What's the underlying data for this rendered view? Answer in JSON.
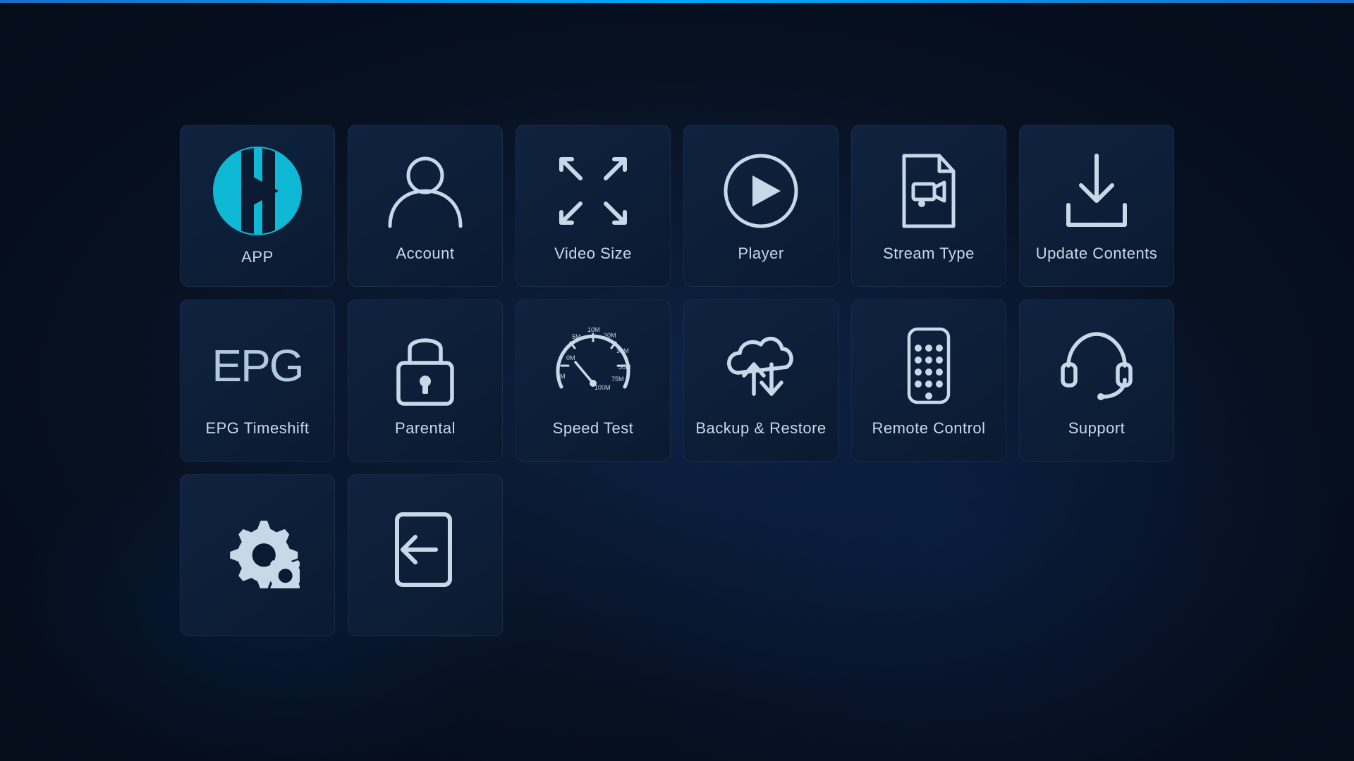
{
  "tiles": [
    {
      "id": "app",
      "label": "APP",
      "icon_type": "app_logo"
    },
    {
      "id": "account",
      "label": "Account",
      "icon_type": "account"
    },
    {
      "id": "video_size",
      "label": "Video Size",
      "icon_type": "video_size"
    },
    {
      "id": "player",
      "label": "Player",
      "icon_type": "player"
    },
    {
      "id": "stream_type",
      "label": "Stream Type",
      "icon_type": "stream_type"
    },
    {
      "id": "update_contents",
      "label": "Update Contents",
      "icon_type": "update_contents"
    },
    {
      "id": "epg_timeshift",
      "label": "EPG Timeshift",
      "icon_type": "epg"
    },
    {
      "id": "parental",
      "label": "Parental",
      "icon_type": "parental"
    },
    {
      "id": "speed_test",
      "label": "Speed Test",
      "icon_type": "speed_test"
    },
    {
      "id": "backup_restore",
      "label": "Backup & Restore",
      "icon_type": "backup_restore"
    },
    {
      "id": "remote_control",
      "label": "Remote Control",
      "icon_type": "remote_control"
    },
    {
      "id": "support",
      "label": "Support",
      "icon_type": "support"
    },
    {
      "id": "settings",
      "label": "",
      "icon_type": "settings"
    },
    {
      "id": "logout",
      "label": "",
      "icon_type": "logout"
    }
  ]
}
